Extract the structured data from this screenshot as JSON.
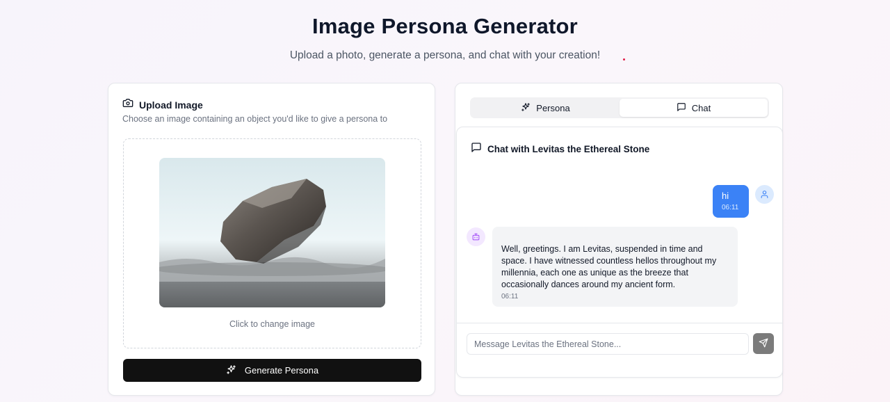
{
  "header": {
    "title": "Image Persona Generator",
    "subtitle": "Upload a photo, generate a persona, and chat with your creation!"
  },
  "upload": {
    "title": "Upload Image",
    "description": "Choose an image containing an object you'd like to give a persona to",
    "change_label": "Click to change image",
    "generate_label": "Generate Persona"
  },
  "tabs": [
    {
      "label": "Persona",
      "icon": "sparkles-icon",
      "active": false
    },
    {
      "label": "Chat",
      "icon": "message-square-icon",
      "active": true
    }
  ],
  "chat": {
    "title": "Chat with Levitas the Ethereal Stone",
    "messages": [
      {
        "role": "user",
        "text": "hi",
        "time": "06:11"
      },
      {
        "role": "bot",
        "text": "Well, greetings. I am Levitas, suspended in time and space. I have witnessed countless hellos throughout my millennia, each one as unique as the breeze that occasionally dances around my ancient form.",
        "time": "06:11"
      }
    ],
    "input_placeholder": "Message Levitas the Ethereal Stone..."
  },
  "colors": {
    "accent": "#3b82f6",
    "button_dark": "#111111",
    "send_button": "#7b7b7b"
  }
}
